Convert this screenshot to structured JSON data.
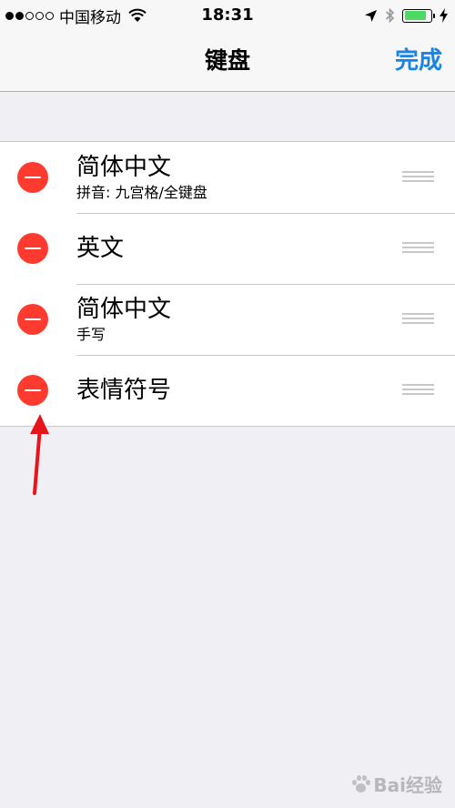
{
  "status_bar": {
    "carrier": "中国移动",
    "time": "18:31",
    "signal_icon": "signal-dots-icon",
    "wifi_icon": "wifi-icon",
    "location_icon": "location-arrow-icon",
    "bluetooth_icon": "bluetooth-icon",
    "battery_icon": "battery-icon",
    "charging_icon": "charging-bolt-icon",
    "battery_level": 0.85
  },
  "nav": {
    "title": "键盘",
    "done_label": "完成"
  },
  "keyboards": [
    {
      "title": "简体中文",
      "subtitle": "拼音: 九宫格/全键盘"
    },
    {
      "title": "英文",
      "subtitle": ""
    },
    {
      "title": "简体中文",
      "subtitle": "手写"
    },
    {
      "title": "表情符号",
      "subtitle": ""
    }
  ],
  "icons": {
    "delete": "delete-minus-icon",
    "reorder": "reorder-handle-icon"
  },
  "annotation": {
    "arrow_color": "#e8141c"
  },
  "watermark": {
    "text": "Bai经验"
  },
  "colors": {
    "accent": "#1a83e6",
    "delete": "#ff3b30",
    "battery": "#4cd964",
    "background": "#efeff4"
  }
}
